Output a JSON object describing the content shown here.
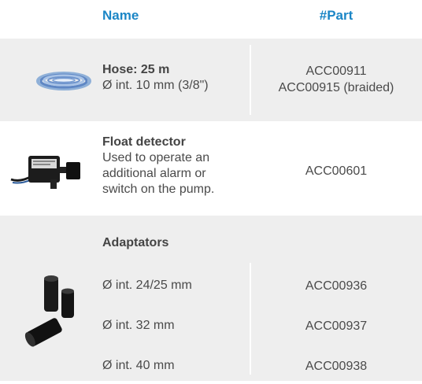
{
  "header": {
    "name_label": "Name",
    "part_label": "#Part"
  },
  "hose": {
    "title": "Hose: 25 m",
    "desc": "Ø int. 10 mm (3/8\")",
    "part1": "ACC00911",
    "part2": "ACC00915 (braided)",
    "image_icon": "coiled-hose-icon"
  },
  "float": {
    "title": "Float detector",
    "desc1": "Used to operate an",
    "desc2": "additional alarm or",
    "desc3": "switch on the pump.",
    "part": "ACC00601",
    "image_icon": "float-detector-icon"
  },
  "adaptators": {
    "title": "Adaptators",
    "items": [
      {
        "name": "Ø int. 24/25 mm",
        "part": "ACC00936"
      },
      {
        "name": "Ø int. 32 mm",
        "part": "ACC00937"
      },
      {
        "name": "Ø int. 40 mm",
        "part": "ACC00938"
      }
    ],
    "image_icon": "adaptors-icon"
  },
  "colors": {
    "accent": "#1b86c6",
    "row_bg": "#eeeeee",
    "text": "#4a4a4a"
  }
}
